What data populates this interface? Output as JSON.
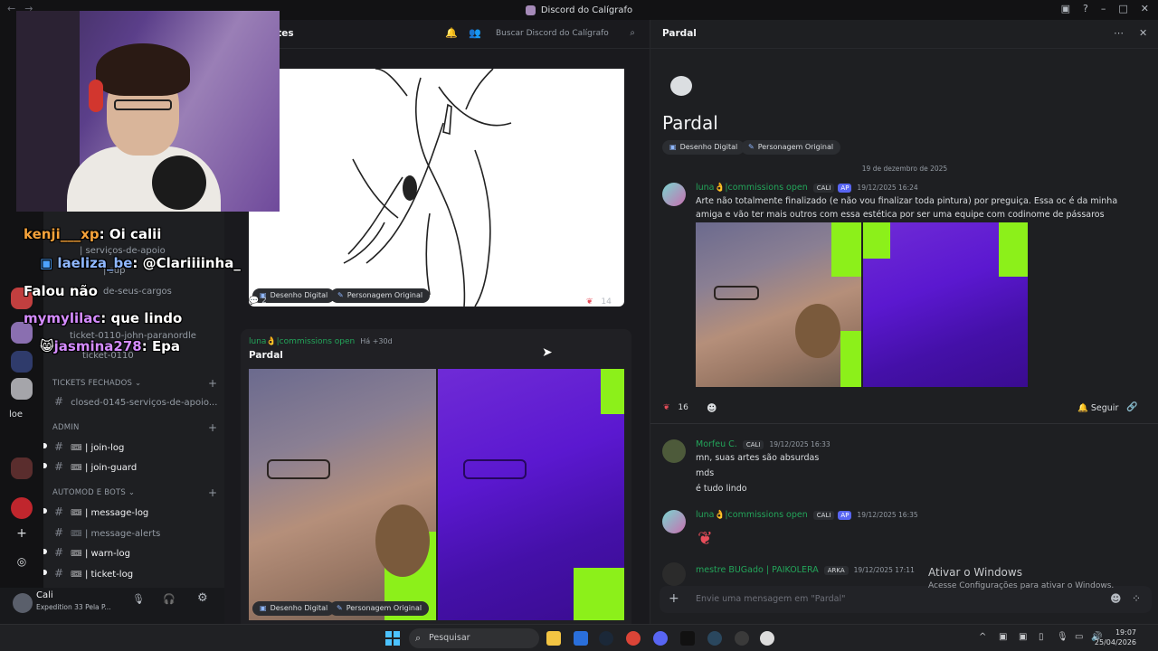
{
  "window": {
    "title": "Discord do Calígrafo"
  },
  "server_rail": {
    "server_label": "loe"
  },
  "webcam": {
    "description": ""
  },
  "stream_chat": [
    {
      "name": "kenji___xp",
      "message": ": Oi calii"
    },
    {
      "name": "laeliza_be",
      "message": ": @Clariiiinha_"
    },
    {
      "name": "",
      "message": "Falou não"
    },
    {
      "name": "mymylilac",
      "message": ": que lindo"
    },
    {
      "name": "jasmina278",
      "message": ": Epa"
    }
  ],
  "channels": {
    "partial_items": [
      "| serviços-de-apoio",
      "| sup",
      "de-seus-cargos",
      "ticket-0110-john-paranordle",
      "ticket-0110"
    ],
    "categories": [
      {
        "label": "TICKETS FECHADOS",
        "items": [
          "closed-0145-serviços-de-apoio..."
        ]
      },
      {
        "label": "ADMIN",
        "items": [
          "| join-log",
          "| join-guard"
        ]
      },
      {
        "label": "AUTOMOD E BOTS",
        "items": [
          "| message-log",
          "| message-alerts",
          "| warn-log",
          "| ticket-log"
        ]
      }
    ]
  },
  "user_panel": {
    "name": "Cali",
    "status": "Expedition 33 Pela P..."
  },
  "main": {
    "header_title": "artes",
    "search_placeholder": "Buscar Discord do Calígrafo",
    "post1": {
      "tags": [
        "Desenho Digital",
        "Personagem Original"
      ],
      "comments": "2",
      "reactions": "14"
    },
    "post2": {
      "author": "luna👌|commissions open",
      "time": "Há +30d",
      "title": "Pardal",
      "tags": [
        "Desenho Digital",
        "Personagem Original"
      ]
    }
  },
  "thread": {
    "header_title": "Pardal",
    "title": "Pardal",
    "tags": [
      "Desenho Digital",
      "Personagem Original"
    ],
    "date_divider": "19 de dezembro de 2025",
    "messages": [
      {
        "author": "luna👌|commissions open",
        "badge": "CALI",
        "ap": "AP",
        "time": "19/12/2025 16:24",
        "text": "Arte não totalmente finalizado (e não vou finalizar toda pintura) por preguiça. Essa oc é da minha amiga e vão ter mais outros com essa estética por ser uma equipe com codinome de pássaros"
      },
      {
        "author": "Morfeu C.",
        "badge": "CALI",
        "time": "19/12/2025 16:33",
        "lines": [
          "mn, suas artes são absurdas",
          "mds",
          "é tudo lindo"
        ]
      },
      {
        "author": "luna👌|commissions open",
        "badge": "CALI",
        "ap": "AP",
        "time": "19/12/2025 16:35"
      },
      {
        "author": "mestre BUGado | PAIKOLERA",
        "badge": "ARKA",
        "time": "19/12/2025 17:11"
      }
    ],
    "reaction_count": "16",
    "follow_label": "Seguir",
    "input_placeholder": "Envie uma mensagem em \"Pardal\""
  },
  "activation": {
    "title": "Ativar o Windows",
    "subtitle": "Acesse Configurações para ativar o Windows."
  },
  "taskbar": {
    "search_label": "Pesquisar",
    "time": "19:07",
    "date": "25/04/2026"
  }
}
